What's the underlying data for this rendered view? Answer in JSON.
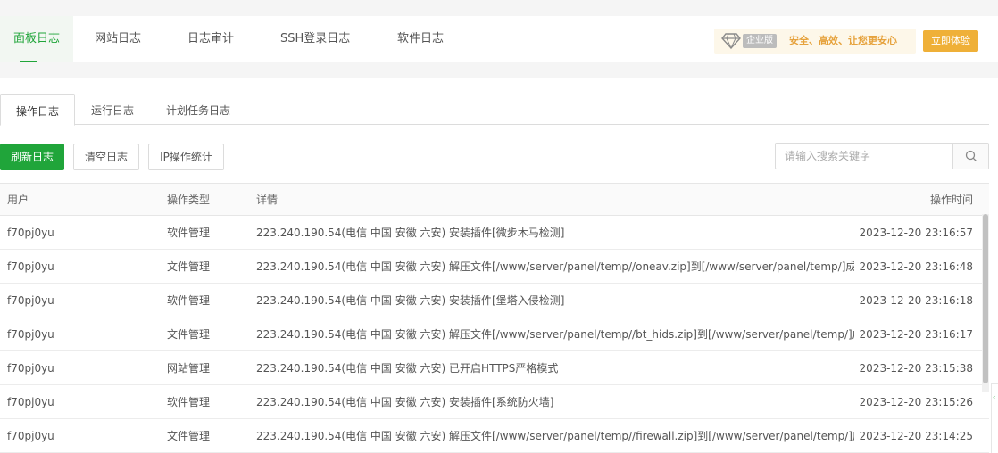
{
  "top_tabs": [
    {
      "label": "面板日志",
      "active": true
    },
    {
      "label": "网站日志",
      "active": false
    },
    {
      "label": "日志审计",
      "active": false
    },
    {
      "label": "SSH登录日志",
      "active": false
    },
    {
      "label": "软件日志",
      "active": false
    }
  ],
  "promo": {
    "icon": "diamond-icon",
    "badge": "企业版",
    "slogan": "安全、高效、让您更安心",
    "button": "立即体验",
    "accent_color": "#efb038"
  },
  "sub_tabs": [
    {
      "label": "操作日志",
      "active": true
    },
    {
      "label": "运行日志",
      "active": false
    },
    {
      "label": "计划任务日志",
      "active": false
    }
  ],
  "toolbar": {
    "refresh": "刷新日志",
    "clear": "清空日志",
    "ip_stats": "IP操作统计",
    "search_placeholder": "请输入搜索关键字",
    "search_icon": "search-icon"
  },
  "table": {
    "columns": [
      "用户",
      "操作类型",
      "详情",
      "操作时间"
    ],
    "rows": [
      {
        "user": "f70pj0yu",
        "type": "软件管理",
        "detail": "223.240.190.54(电信 中国 安徽 六安) 安装插件[微步木马检测]",
        "time": "2023-12-20 23:16:57"
      },
      {
        "user": "f70pj0yu",
        "type": "文件管理",
        "detail": "223.240.190.54(电信 中国 安徽 六安) 解压文件[/www/server/panel/temp//oneav.zip]到[/www/server/panel/temp/]成功!",
        "time": "2023-12-20 23:16:48"
      },
      {
        "user": "f70pj0yu",
        "type": "软件管理",
        "detail": "223.240.190.54(电信 中国 安徽 六安) 安装插件[堡塔入侵检测]",
        "time": "2023-12-20 23:16:18"
      },
      {
        "user": "f70pj0yu",
        "type": "文件管理",
        "detail": "223.240.190.54(电信 中国 安徽 六安) 解压文件[/www/server/panel/temp//bt_hids.zip]到[/www/server/panel/temp/]成功",
        "time": "2023-12-20 23:16:17"
      },
      {
        "user": "f70pj0yu",
        "type": "网站管理",
        "detail": "223.240.190.54(电信 中国 安徽 六安) 已开启HTTPS严格模式",
        "time": "2023-12-20 23:15:38"
      },
      {
        "user": "f70pj0yu",
        "type": "软件管理",
        "detail": "223.240.190.54(电信 中国 安徽 六安) 安装插件[系统防火墙]",
        "time": "2023-12-20 23:15:26"
      },
      {
        "user": "f70pj0yu",
        "type": "文件管理",
        "detail": "223.240.190.54(电信 中国 安徽 六安) 解压文件[/www/server/panel/temp//firewall.zip]到[/www/server/panel/temp/]成功",
        "time": "2023-12-20 23:14:25"
      }
    ]
  },
  "colors": {
    "brand_green": "#20a53a",
    "promo_gold": "#e6a23c"
  }
}
